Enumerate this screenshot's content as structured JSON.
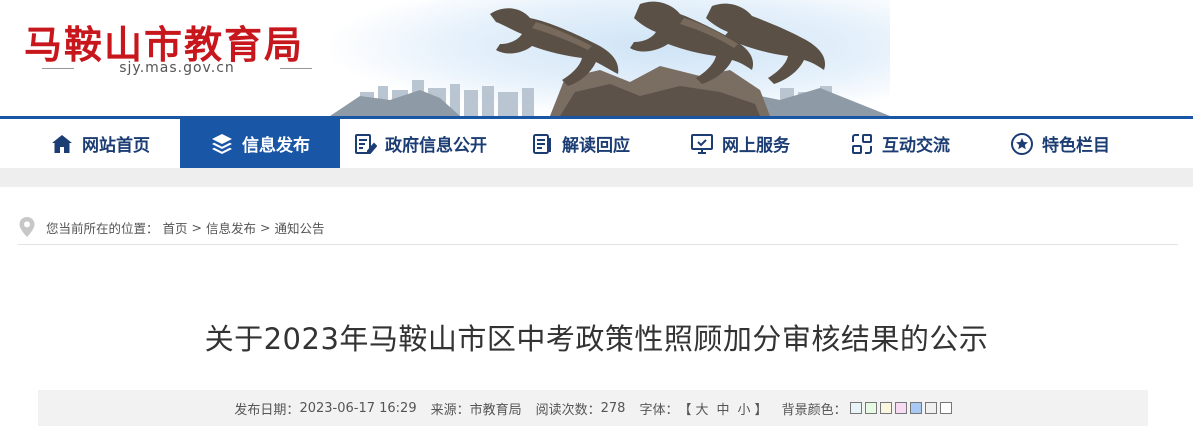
{
  "header": {
    "site_title": "马鞍山市教育局",
    "domain": "sjy.mas.gov.cn"
  },
  "nav": {
    "active_color": "#1a56a6",
    "items": [
      {
        "label": "网站首页",
        "icon": "home-icon"
      },
      {
        "label": "信息发布",
        "icon": "layers-icon"
      },
      {
        "label": "政府信息公开",
        "icon": "document-edit-icon"
      },
      {
        "label": "解读回应",
        "icon": "clipboard-icon"
      },
      {
        "label": "网上服务",
        "icon": "monitor-icon"
      },
      {
        "label": "互动交流",
        "icon": "interaction-icon"
      },
      {
        "label": "特色栏目",
        "icon": "star-icon"
      }
    ],
    "active_index": 1
  },
  "breadcrumb": {
    "prefix": "您当前所在的位置：",
    "items": [
      "首页",
      "信息发布",
      "通知公告"
    ],
    "separator": ">"
  },
  "article": {
    "title": "关于2023年马鞍山市区中考政策性照顾加分审核结果的公示",
    "meta": {
      "date_label": "发布日期：",
      "date_value": "2023-06-17 16:29",
      "source_label": "来源：",
      "source_value": "市教育局",
      "views_label": "阅读次数：",
      "views_value": "278",
      "font_label": "字体：",
      "font_open": "【",
      "font_large": "大",
      "font_medium": "中",
      "font_small": "小",
      "font_close": "】",
      "bg_label": "背景颜色：",
      "bg_swatches": [
        "#e8f4f8",
        "#e6fae6",
        "#fbf6df",
        "#f7dbf2",
        "#a9c8f2",
        "#f0f0f0",
        "#ffffff"
      ]
    }
  }
}
